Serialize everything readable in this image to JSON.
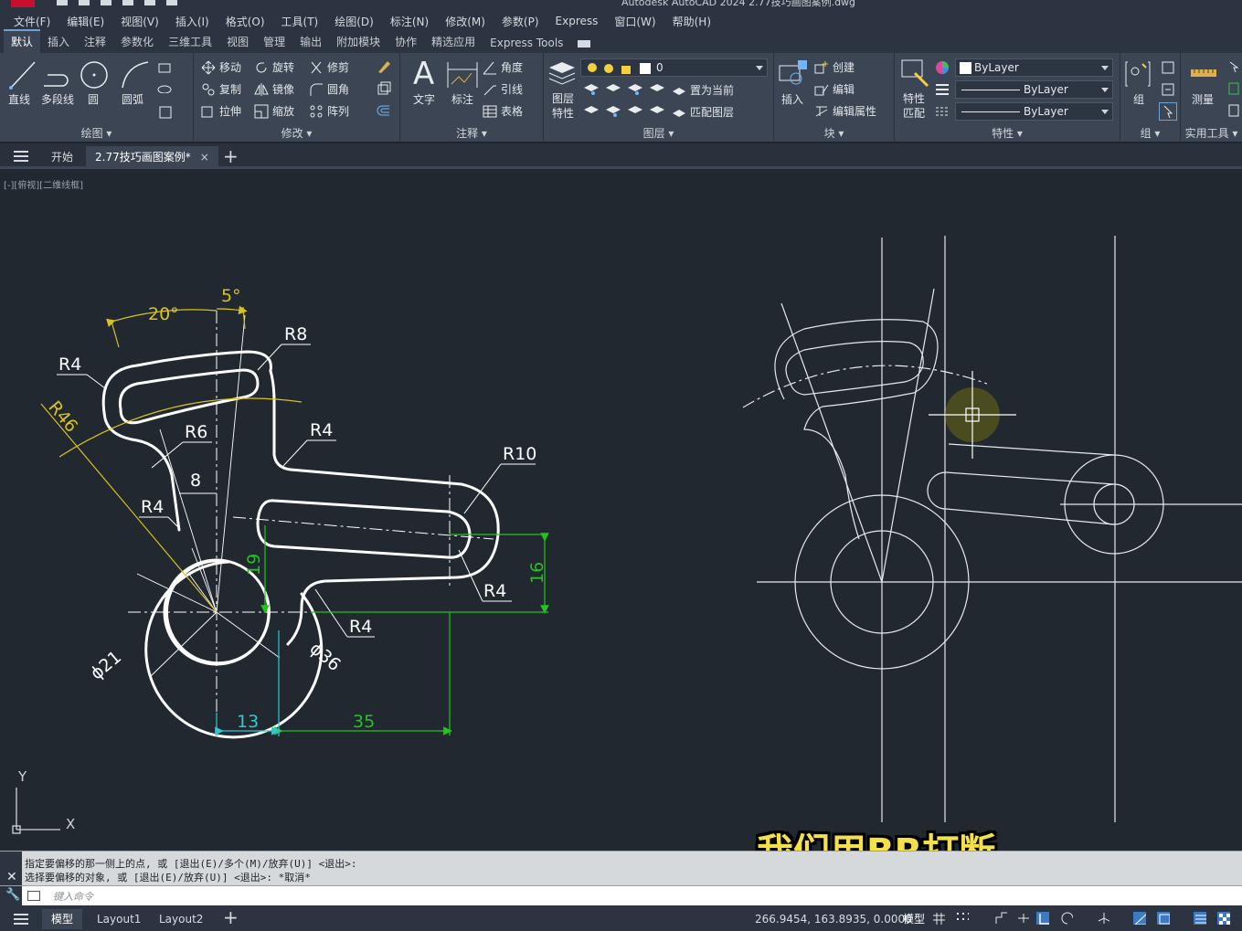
{
  "window": {
    "title": "Autodesk AutoCAD 2024  2.77技巧画图案例.dwg"
  },
  "menu": [
    "文件(F)",
    "编辑(E)",
    "视图(V)",
    "插入(I)",
    "格式(O)",
    "工具(T)",
    "绘图(D)",
    "标注(N)",
    "修改(M)",
    "参数(P)",
    "Express",
    "窗口(W)",
    "帮助(H)"
  ],
  "ribbon_tabs": [
    "默认",
    "插入",
    "注释",
    "参数化",
    "三维工具",
    "视图",
    "管理",
    "输出",
    "附加模块",
    "协作",
    "精选应用",
    "Express Tools"
  ],
  "ribbon": {
    "draw": {
      "title": "绘图 ▾",
      "line": "直线",
      "polyline": "多段线",
      "circle": "圆",
      "arc": "圆弧"
    },
    "modify": {
      "title": "修改 ▾",
      "move": "移动",
      "rotate": "旋转",
      "trim": "修剪",
      "copy": "复制",
      "mirror": "镜像",
      "fillet": "圆角",
      "stretch": "拉伸",
      "scale": "缩放",
      "array": "阵列"
    },
    "annotation": {
      "title": "注释 ▾",
      "text": "文字",
      "dimension": "标注",
      "angle": "角度",
      "leader": "引线",
      "table": "表格"
    },
    "layers": {
      "title": "图层 ▾",
      "layer_props": "图层\n特性",
      "layer_name": "0",
      "set_current": "置为当前",
      "match_layer": "匹配图层"
    },
    "block": {
      "title": "块 ▾",
      "insert": "插入",
      "create": "创建",
      "edit": "编辑",
      "edit_attr": "编辑属性"
    },
    "properties": {
      "title": "特性 ▾",
      "match_props": "特性\n匹配",
      "color": "ByLayer",
      "linetype": "ByLayer",
      "lineweight": "ByLayer"
    },
    "groups": {
      "title": "组 ▾",
      "group": "组"
    },
    "utilities": {
      "title": "实用工具 ▾",
      "measure": "测量"
    }
  },
  "doc_tabs": {
    "start": "开始",
    "active": "2.77技巧画图案例*",
    "close": "×",
    "add": "+"
  },
  "viewport_label": "[-][俯视][二维线框]",
  "drawing": {
    "dims": {
      "ang20": "20°",
      "ang5": "5°",
      "r8": "R8",
      "r4_top": "R4",
      "r46": "R46",
      "r6": "R6",
      "r4_mid": "R4",
      "d8": "8",
      "r4_left": "R4",
      "r10": "R10",
      "d19": "19",
      "d16": "16",
      "r4_slot": "R4",
      "r4_low": "R4",
      "phi21": "ϕ21",
      "phi36": "ϕ36",
      "d13": "13",
      "d35": "35"
    },
    "ucs": {
      "x": "X",
      "y": "Y"
    }
  },
  "command": {
    "history": [
      "指定要偏移的那一侧上的点, 或 [退出(E)/多个(M)/放弃(U)] <退出>:",
      "选择要偏移的对象, 或 [退出(E)/放弃(U)] <退出>:  *取消*"
    ],
    "placeholder": "键入命令"
  },
  "status": {
    "layouts": [
      "模型",
      "Layout1",
      "Layout2"
    ],
    "add": "+",
    "coords": "266.9454, 163.8935, 0.0000",
    "model": "模型"
  },
  "subtitle": "我们用BR打断",
  "colors": {
    "accent": "#6aa3d8",
    "dim_yellow": "#d9c21e",
    "dim_green": "#22c51e",
    "dim_cyan": "#2fc8d6",
    "subtitle": "#f4e04a"
  }
}
